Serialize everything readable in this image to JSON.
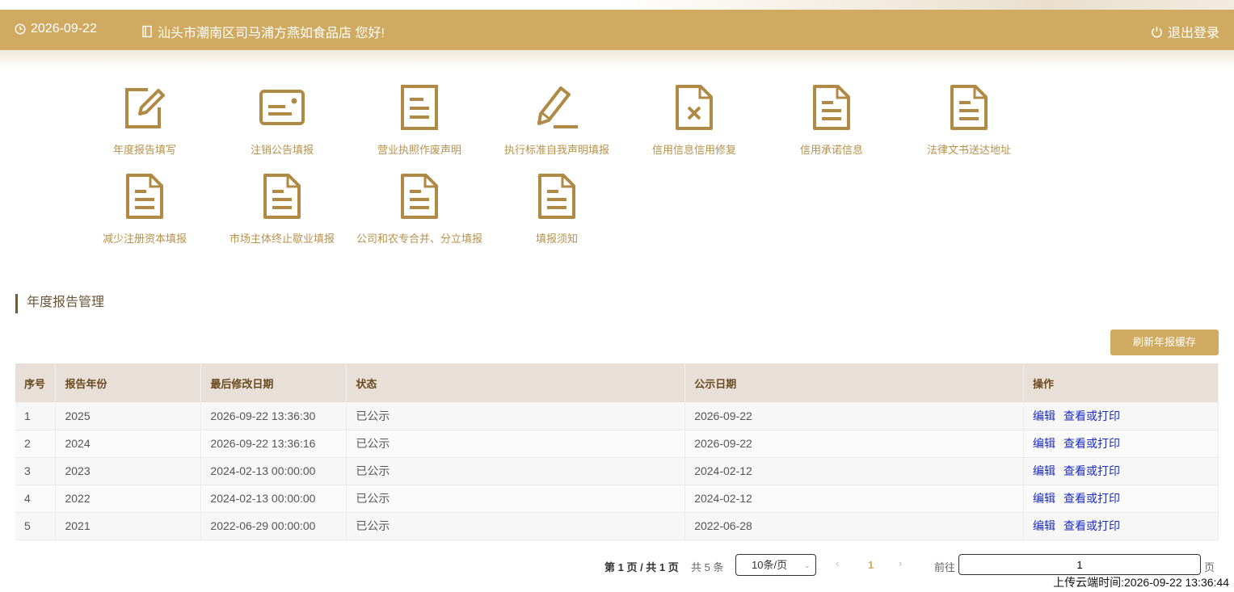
{
  "header": {
    "date": "2026-09-22",
    "greeting": "汕头市潮南区司马浦方燕如食品店 您好!",
    "logout": "退出登录"
  },
  "menu": [
    {
      "label": "年度报告填写",
      "icon": "edit-icon"
    },
    {
      "label": "注销公告填报",
      "icon": "id-card-icon"
    },
    {
      "label": "营业执照作废声明",
      "icon": "document-icon"
    },
    {
      "label": "执行标准自我声明填报",
      "icon": "pencil-icon"
    },
    {
      "label": "信用信息信用修复",
      "icon": "document-x-icon"
    },
    {
      "label": "信用承诺信息",
      "icon": "document-icon"
    },
    {
      "label": "法律文书送达地址",
      "icon": "document-icon"
    },
    {
      "label": "减少注册资本填报",
      "icon": "document-icon"
    },
    {
      "label": "市场主体终止歇业填报",
      "icon": "document-icon"
    },
    {
      "label": "公司和农专合并、分立填报",
      "icon": "document-icon"
    },
    {
      "label": "填报须知",
      "icon": "document-icon"
    }
  ],
  "section": {
    "title": "年度报告管理",
    "refresh_button": "刷新年报缓存"
  },
  "table": {
    "columns": [
      "序号",
      "报告年份",
      "最后修改日期",
      "状态",
      "公示日期",
      "操作"
    ],
    "rows": [
      {
        "no": "1",
        "year": "2025",
        "modified": "2026-09-22 13:36:30",
        "status": "已公示",
        "publish": "2026-09-22",
        "edit": "编辑",
        "view": "查看或打印"
      },
      {
        "no": "2",
        "year": "2024",
        "modified": "2026-09-22 13:36:16",
        "status": "已公示",
        "publish": "2026-09-22",
        "edit": "编辑",
        "view": "查看或打印"
      },
      {
        "no": "3",
        "year": "2023",
        "modified": "2024-02-13 00:00:00",
        "status": "已公示",
        "publish": "2024-02-12",
        "edit": "编辑",
        "view": "查看或打印"
      },
      {
        "no": "4",
        "year": "2022",
        "modified": "2024-02-13 00:00:00",
        "status": "已公示",
        "publish": "2024-02-12",
        "edit": "编辑",
        "view": "查看或打印"
      },
      {
        "no": "5",
        "year": "2021",
        "modified": "2022-06-29 00:00:00",
        "status": "已公示",
        "publish": "2022-06-28",
        "edit": "编辑",
        "view": "查看或打印"
      }
    ]
  },
  "pager": {
    "summary": "第 1 页 / 共 1 页",
    "total": "共 5 条",
    "page_size": "10条/页",
    "current": "1",
    "goto_label": "前往",
    "goto_value": "1",
    "page_suffix": "页"
  },
  "upload_time": "上传云端时间:2026-09-22 13:36:44",
  "colors": {
    "accent": "#cfaa60",
    "icon": "#b08a45",
    "link": "#1a2bbf"
  }
}
